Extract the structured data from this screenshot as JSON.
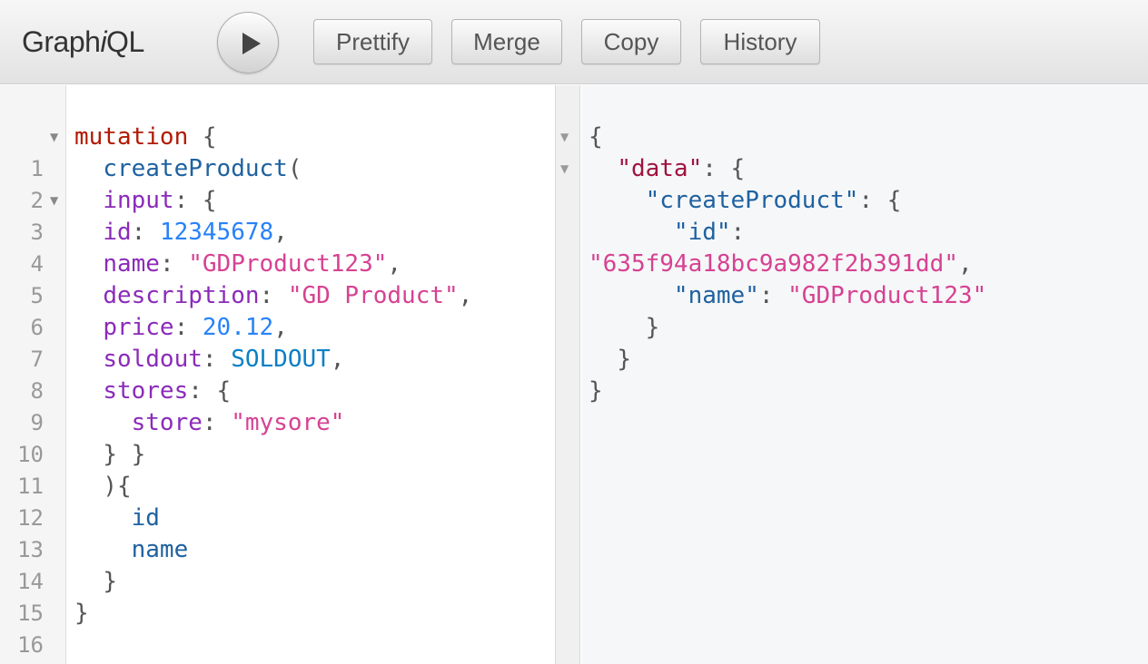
{
  "app": {
    "logo_prefix": "Graph",
    "logo_italic": "i",
    "logo_suffix": "QL"
  },
  "toolbar": {
    "run_label": "Execute Query",
    "prettify": "Prettify",
    "merge": "Merge",
    "copy": "Copy",
    "history": "History"
  },
  "query": {
    "line_numbers": [
      "1",
      "2",
      "3",
      "4",
      "5",
      "6",
      "7",
      "8",
      "9",
      "10",
      "11",
      "12",
      "13",
      "14",
      "15",
      "16"
    ],
    "l1": {
      "kw": "mutation",
      "p": " {"
    },
    "l2": {
      "def": "createProduct",
      "p": "("
    },
    "l3": {
      "attr": "input",
      "p": ": {"
    },
    "l4": {
      "attr": "id",
      "p1": ": ",
      "num": "12345678",
      "p2": ","
    },
    "l5": {
      "attr": "name",
      "p1": ": ",
      "str": "\"GDProduct123\"",
      "p2": ","
    },
    "l6": {
      "attr": "description",
      "p1": ": ",
      "str": "\"GD Product\"",
      "p2": ","
    },
    "l7": {
      "attr": "price",
      "p1": ": ",
      "num": "20.12",
      "p2": ","
    },
    "l8": {
      "attr": "soldout",
      "p1": ": ",
      "enum": "SOLDOUT",
      "p2": ","
    },
    "l9": {
      "attr": "stores",
      "p": ": {"
    },
    "l10": {
      "attr": "store",
      "p1": ": ",
      "str": "\"mysore\""
    },
    "l11": {
      "p": "} }"
    },
    "l12": {
      "p": "){"
    },
    "l13": {
      "fld": "id"
    },
    "l14": {
      "fld": "name"
    },
    "l15": {
      "p": "}"
    },
    "l16": {
      "p": "}"
    }
  },
  "result": {
    "r1": "{",
    "r2": {
      "key": "\"data\"",
      "p": ": {"
    },
    "r3": {
      "key": "\"createProduct\"",
      "p": ": {"
    },
    "r4": {
      "key": "\"id\"",
      "p": ":"
    },
    "r5": {
      "str": "\"635f94a18bc9a982f2b391dd\"",
      "p": ","
    },
    "r6": {
      "key": "\"name\"",
      "p": ": ",
      "str": "\"GDProduct123\""
    },
    "r7": "}",
    "r8": "}",
    "r9": "}"
  },
  "colors": {
    "keyword": "#b11a04",
    "definition": "#1f61a0",
    "attribute": "#8b2bb9",
    "number": "#2882f9",
    "string": "#d64292",
    "enum": "#0b7fc7"
  },
  "icons": {
    "run": "play-icon",
    "fold": "fold-arrow-icon"
  }
}
